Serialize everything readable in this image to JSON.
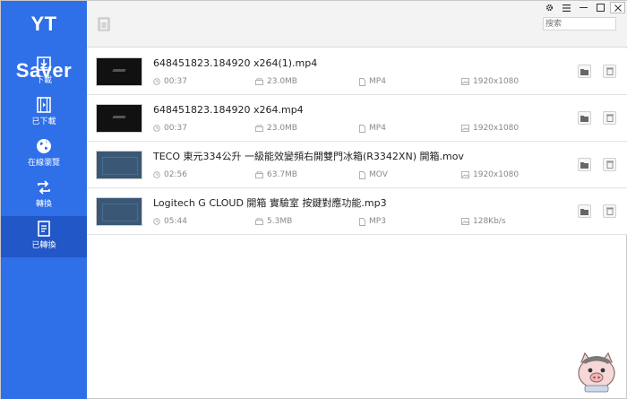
{
  "app": {
    "title": "YT Saver"
  },
  "sidebar": {
    "items": [
      {
        "label": "下載",
        "icon": "download-icon",
        "active": false
      },
      {
        "label": "已下載",
        "icon": "film-icon",
        "active": false
      },
      {
        "label": "在線瀏覽",
        "icon": "globe-icon",
        "active": false
      },
      {
        "label": "轉換",
        "icon": "convert-icon",
        "active": false
      },
      {
        "label": "已轉換",
        "icon": "document-icon",
        "active": true
      }
    ]
  },
  "topbar": {
    "search_placeholder": "搜索",
    "controls": [
      "gear-icon",
      "menu-icon",
      "minimize-icon",
      "maximize-icon",
      "close-icon"
    ]
  },
  "files": [
    {
      "name": "648451823.184920  x264(1).mp4",
      "duration": "00:37",
      "size": "23.0MB",
      "format": "MP4",
      "quality": "1920x1080",
      "thumb": "dark"
    },
    {
      "name": "648451823.184920  x264.mp4",
      "duration": "00:37",
      "size": "23.0MB",
      "format": "MP4",
      "quality": "1920x1080",
      "thumb": "dark"
    },
    {
      "name": "TECO 東元334公升 一級能效變頻右開雙門冰箱(R3342XN) 開箱.mov",
      "duration": "02:56",
      "size": "63.7MB",
      "format": "MOV",
      "quality": "1920x1080",
      "thumb": "blue"
    },
    {
      "name": "Logitech G CLOUD 開箱 實驗室 按鍵對應功能.mp3",
      "duration": "05:44",
      "size": "5.3MB",
      "format": "MP3",
      "quality": "128Kb/s",
      "thumb": "blue"
    }
  ],
  "colors": {
    "sidebar": "#2f6fe8",
    "sidebar_active": "#2157c7",
    "topbar": "#f3f3f3"
  }
}
